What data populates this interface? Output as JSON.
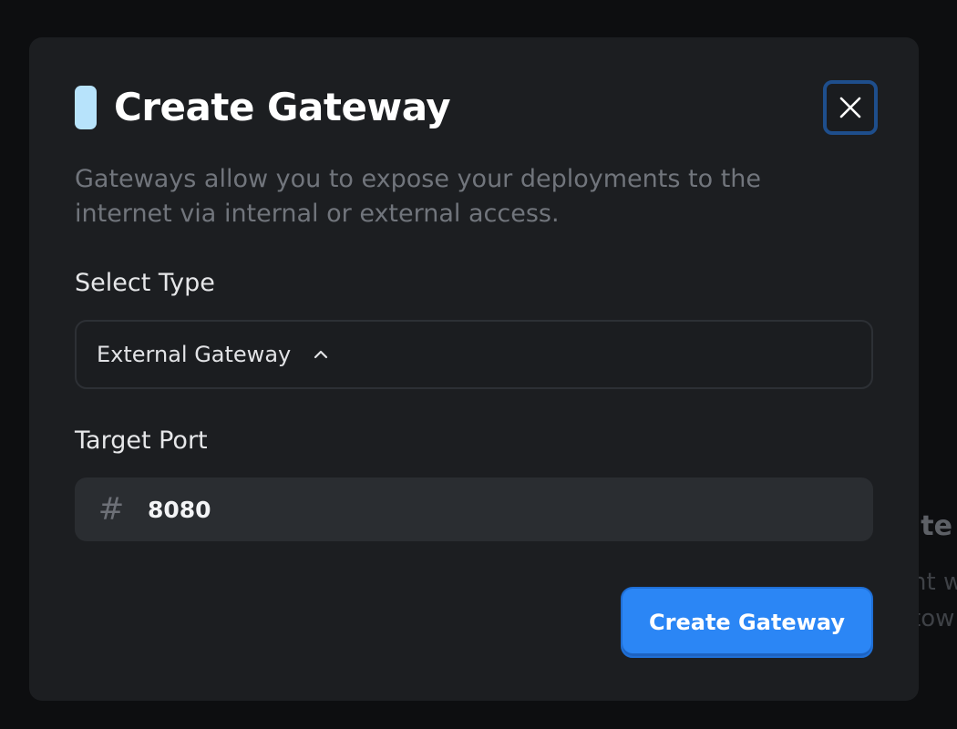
{
  "backdrop": {
    "title_fragment": "ate",
    "line1_fragment": "nt w",
    "line2_fragment": "tow"
  },
  "modal": {
    "title": "Create Gateway",
    "accent_color": "#b7e3fb",
    "close_icon": "close-icon",
    "description": "Gateways allow you to expose your deployments to the internet via internal or external access.",
    "select_type": {
      "label": "Select Type",
      "value": "External Gateway",
      "expanded": true,
      "icon": "chevron-up-icon"
    },
    "target_port": {
      "label": "Target Port",
      "value": "8080",
      "icon": "hash-icon"
    },
    "submit_label": "Create Gateway",
    "primary_color": "#2b86f5"
  }
}
